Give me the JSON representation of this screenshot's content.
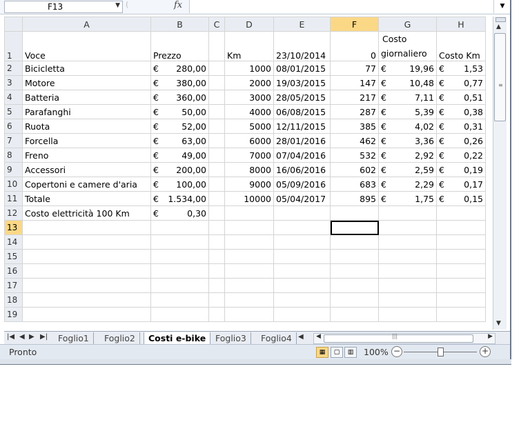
{
  "formula_bar": {
    "name_box": "F13",
    "fx": "fx",
    "formula": ""
  },
  "columns": [
    "A",
    "B",
    "C",
    "D",
    "E",
    "F",
    "G",
    "H"
  ],
  "selected_column": "F",
  "selected_row": 13,
  "header_row": {
    "a": "Voce",
    "b": "Prezzo",
    "c": "",
    "d": "Km",
    "e": "23/10/2014",
    "f": "0",
    "g_line1": "Costo",
    "g_line2": "giornaliero",
    "h": "Costo Km"
  },
  "rows": [
    {
      "n": "2",
      "a": "Bicicletta",
      "b_cur": "€",
      "b": "280,00",
      "d": "1000",
      "e": "08/01/2015",
      "f": "77",
      "g_cur": "€",
      "g": "19,96",
      "h_cur": "€",
      "h": "1,53"
    },
    {
      "n": "3",
      "a": "Motore",
      "b_cur": "€",
      "b": "380,00",
      "d": "2000",
      "e": "19/03/2015",
      "f": "147",
      "g_cur": "€",
      "g": "10,48",
      "h_cur": "€",
      "h": "0,77"
    },
    {
      "n": "4",
      "a": "Batteria",
      "b_cur": "€",
      "b": "360,00",
      "d": "3000",
      "e": "28/05/2015",
      "f": "217",
      "g_cur": "€",
      "g": "7,11",
      "h_cur": "€",
      "h": "0,51"
    },
    {
      "n": "5",
      "a": "Parafanghi",
      "b_cur": "€",
      "b": "50,00",
      "d": "4000",
      "e": "06/08/2015",
      "f": "287",
      "g_cur": "€",
      "g": "5,39",
      "h_cur": "€",
      "h": "0,38"
    },
    {
      "n": "6",
      "a": "Ruota",
      "b_cur": "€",
      "b": "52,00",
      "d": "5000",
      "e": "12/11/2015",
      "f": "385",
      "g_cur": "€",
      "g": "4,02",
      "h_cur": "€",
      "h": "0,31"
    },
    {
      "n": "7",
      "a": "Forcella",
      "b_cur": "€",
      "b": "63,00",
      "d": "6000",
      "e": "28/01/2016",
      "f": "462",
      "g_cur": "€",
      "g": "3,36",
      "h_cur": "€",
      "h": "0,26"
    },
    {
      "n": "8",
      "a": "Freno",
      "b_cur": "€",
      "b": "49,00",
      "d": "7000",
      "e": "07/04/2016",
      "f": "532",
      "g_cur": "€",
      "g": "2,92",
      "h_cur": "€",
      "h": "0,22"
    },
    {
      "n": "9",
      "a": "Accessori",
      "b_cur": "€",
      "b": "200,00",
      "d": "8000",
      "e": "16/06/2016",
      "f": "602",
      "g_cur": "€",
      "g": "2,59",
      "h_cur": "€",
      "h": "0,19"
    },
    {
      "n": "10",
      "a": "Copertoni e camere d'aria",
      "b_cur": "€",
      "b": "100,00",
      "d": "9000",
      "e": "05/09/2016",
      "f": "683",
      "g_cur": "€",
      "g": "2,29",
      "h_cur": "€",
      "h": "0,17"
    },
    {
      "n": "11",
      "a": "Totale",
      "b_cur": "€",
      "b": "1.534,00",
      "d": "10000",
      "e": "05/04/2017",
      "f": "895",
      "g_cur": "€",
      "g": "1,75",
      "h_cur": "€",
      "h": "0,15"
    },
    {
      "n": "12",
      "a": "Costo elettricità 100 Km",
      "b_cur": "€",
      "b": "0,30",
      "d": "",
      "e": "",
      "f": "",
      "g_cur": "",
      "g": "",
      "h_cur": "",
      "h": ""
    }
  ],
  "empty_rows": [
    "13",
    "14",
    "15",
    "16",
    "17",
    "18",
    "19"
  ],
  "sheet_tabs": [
    "Foglio1",
    "Foglio2",
    "Costi e-bike",
    "Foglio3",
    "Foglio4"
  ],
  "active_tab": "Costi e-bike",
  "status": {
    "text": "Pronto",
    "zoom": "100%"
  }
}
